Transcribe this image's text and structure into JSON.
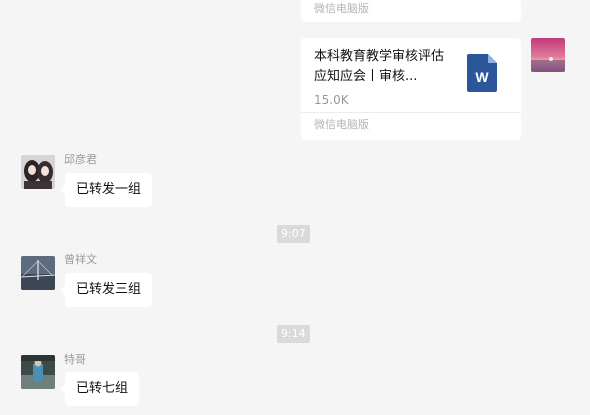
{
  "messages": {
    "top_card": {
      "footer": "微信电脑版"
    },
    "file_card": {
      "name": "本科教育教学审核评估应知应会丨审核...",
      "size": "15.0K",
      "footer": "微信电脑版",
      "icon": "word-file-icon",
      "icon_letter": "W"
    },
    "msg1": {
      "sender": "邱彦君",
      "text": "已转发一组"
    },
    "time1": "9:07",
    "msg2": {
      "sender": "曾祥文",
      "text": "已转发三组"
    },
    "time2": "9:14",
    "msg3": {
      "sender": "特哥",
      "text": "已转七组"
    }
  },
  "colors": {
    "background": "#f5f5f5",
    "bubble": "#ffffff",
    "word_blue": "#2b579a",
    "muted_text": "#9a9a9a"
  }
}
